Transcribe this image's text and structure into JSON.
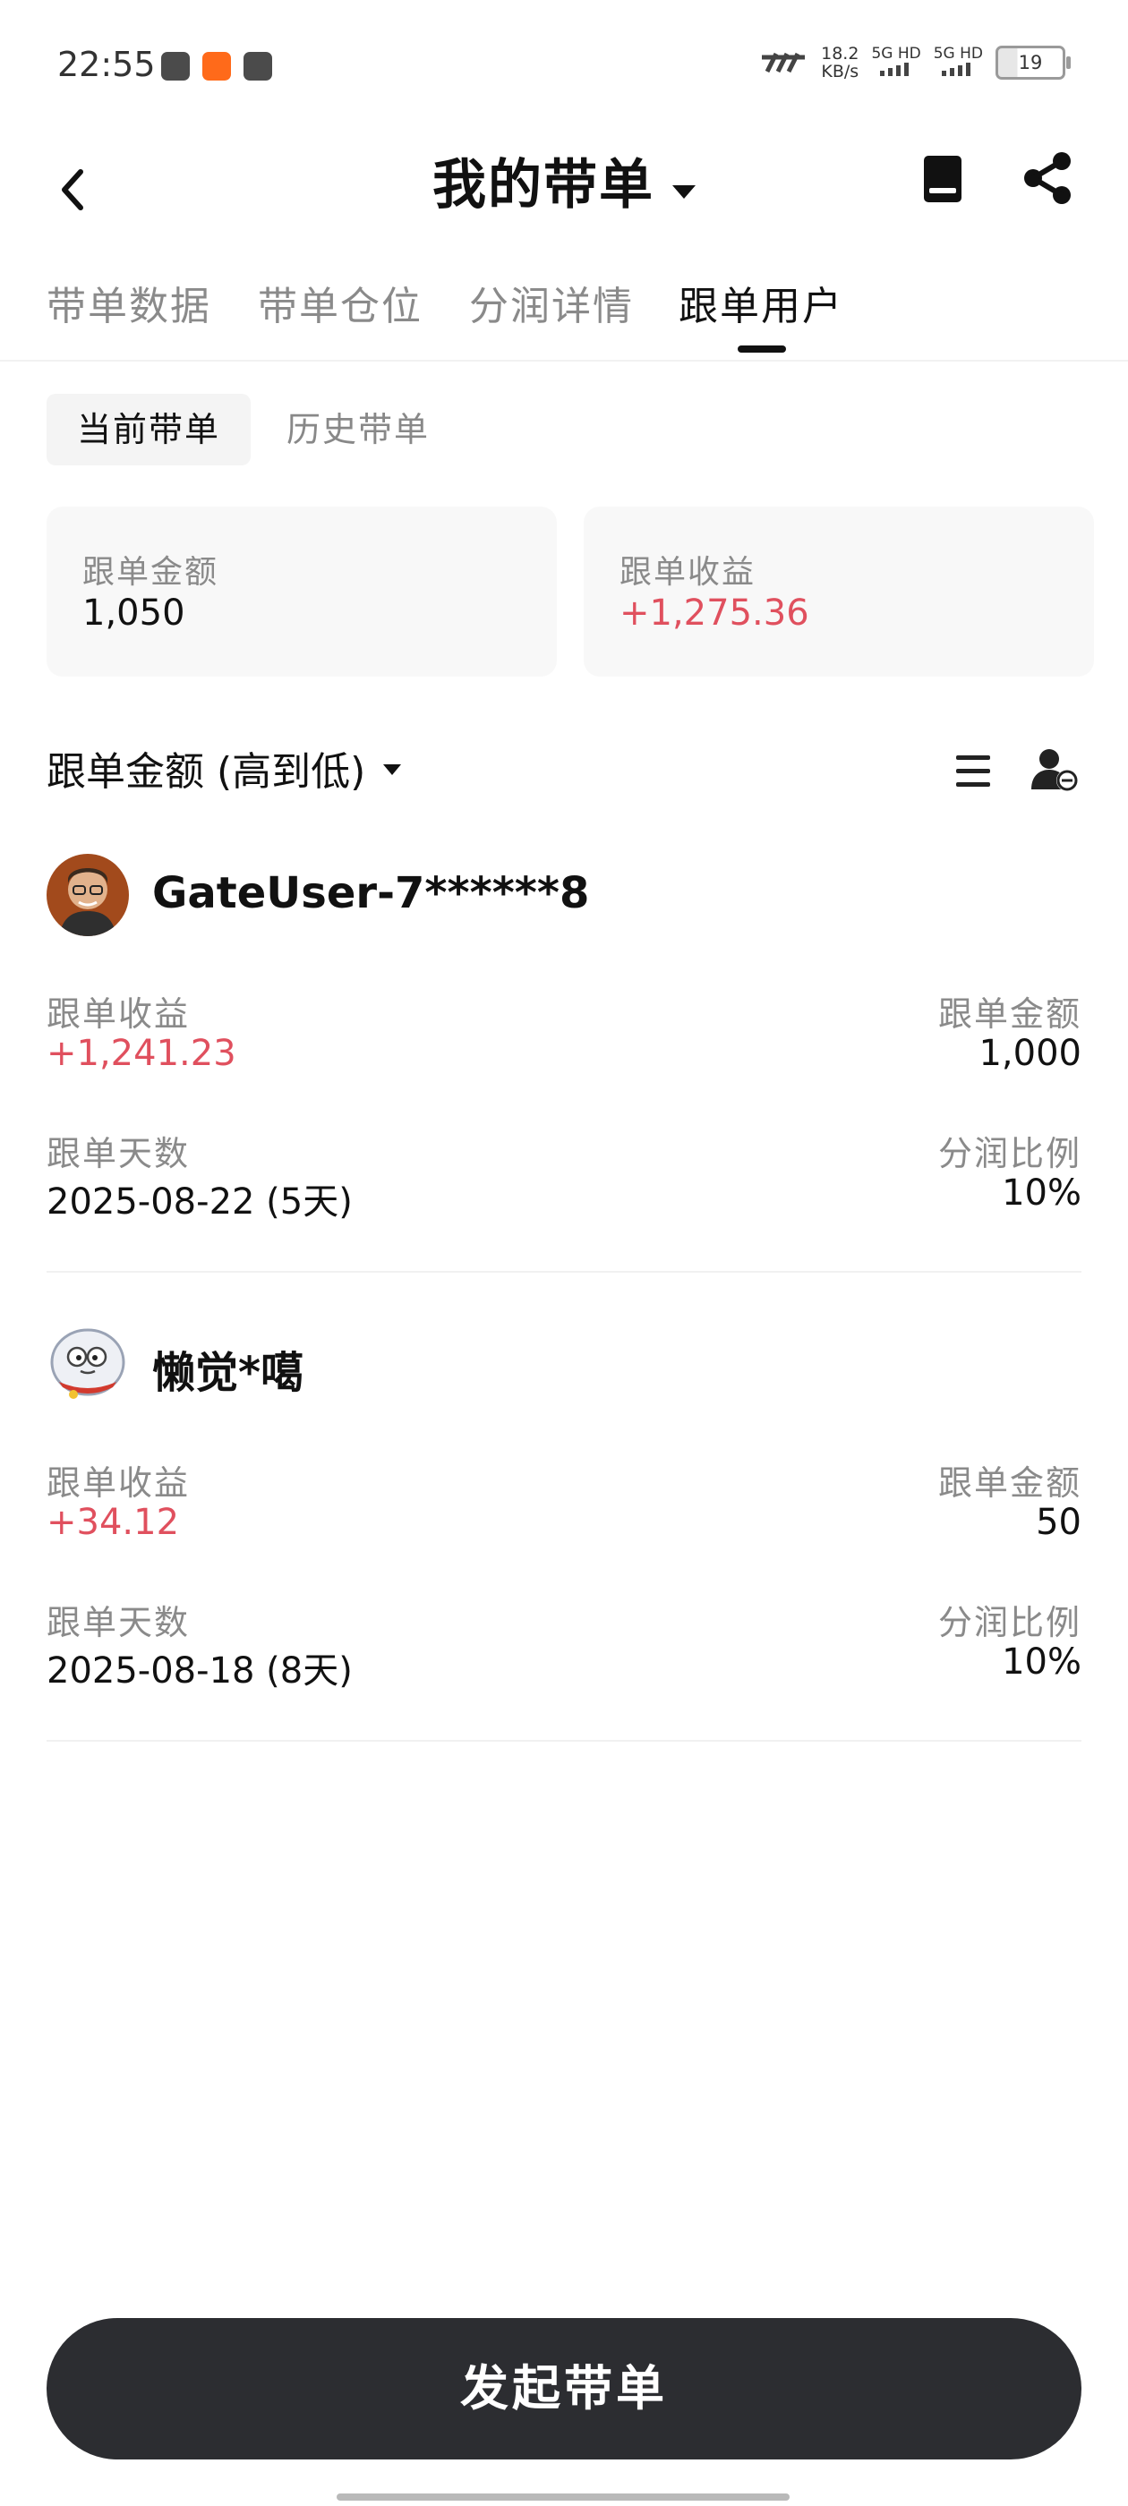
{
  "status_bar": {
    "time": "22:55",
    "net_speed_value": "18.2",
    "net_speed_unit": "KB/s",
    "signal1": "5G HD",
    "signal2": "5G HD",
    "battery": "19"
  },
  "nav": {
    "title": "我的带单"
  },
  "tabs": [
    {
      "label": "带单数据"
    },
    {
      "label": "带单仓位"
    },
    {
      "label": "分润详情"
    },
    {
      "label": "跟单用户"
    }
  ],
  "subtabs": [
    {
      "label": "当前带单"
    },
    {
      "label": "历史带单"
    }
  ],
  "summary": {
    "amount_label": "跟单金额",
    "amount_value": "1,050",
    "profit_label": "跟单收益",
    "profit_value": "+1,275.36"
  },
  "sort": {
    "label": "跟单金额 (高到低)"
  },
  "followers": [
    {
      "name": "GateUser-7******8",
      "profit_label": "跟单收益",
      "profit_value": "+1,241.23",
      "amount_label": "跟单金额",
      "amount_value": "1,000",
      "days_label": "跟单天数",
      "days_value": "2025-08-22 (5天)",
      "ratio_label": "分润比例",
      "ratio_value": "10%"
    },
    {
      "name": "懒觉*噶",
      "profit_label": "跟单收益",
      "profit_value": "+34.12",
      "amount_label": "跟单金额",
      "amount_value": "50",
      "days_label": "跟单天数",
      "days_value": "2025-08-18 (8天)",
      "ratio_label": "分润比例",
      "ratio_value": "10%"
    }
  ],
  "cta": {
    "label": "发起带单"
  },
  "colors": {
    "positive": "#e0505e",
    "cta_bg": "#2c2d31",
    "muted_text": "#8a8a8a"
  }
}
